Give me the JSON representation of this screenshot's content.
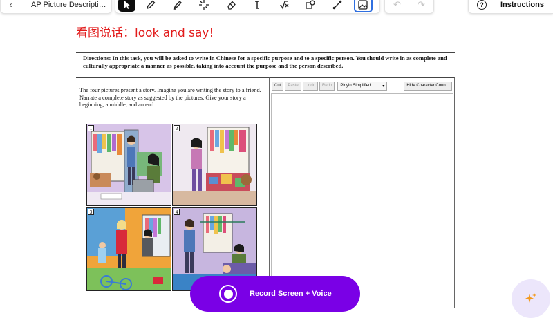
{
  "toolbar": {
    "back_icon": "chevron-left-icon",
    "doc_title": "AP Picture Descripti…",
    "tools": [
      "select-cursor-icon",
      "pen-icon",
      "highlighter-icon",
      "laser-pointer-icon",
      "eraser-icon",
      "text-icon",
      "math-icon",
      "shapes-icon",
      "line-icon",
      "image-icon"
    ],
    "undo_icon": "undo-icon",
    "redo_icon": "redo-icon",
    "help_icon": "?",
    "instructions_label": "Instructions"
  },
  "prompt": "看图说话：look and say!",
  "directions": "Directions: In this task, you will be asked to write in Chinese for a specific purpose and to a specific person. You should write in as complete and culturally appropriate a manner as possible, taking into account the purpose and the person described.",
  "task_text": "The four pictures present a story.  Imagine you are writing the story to a friend.  Narrate a complete story as suggested by the pictures.  Give your story a beginning, a middle, and an end.",
  "panels": [
    "1",
    "2",
    "3",
    "4"
  ],
  "editor": {
    "cut": "Cut",
    "paste": "Paste",
    "undo": "Undo",
    "redo": "Redo",
    "input_mode": "Pinyin Simplified",
    "hide_count": "Hide Character Coun"
  },
  "record_label": "Record Screen + Voice",
  "colors": {
    "accent_purple": "#7a00e6",
    "prompt_red": "#e21b1b",
    "active_blue": "#2f6fe0"
  }
}
